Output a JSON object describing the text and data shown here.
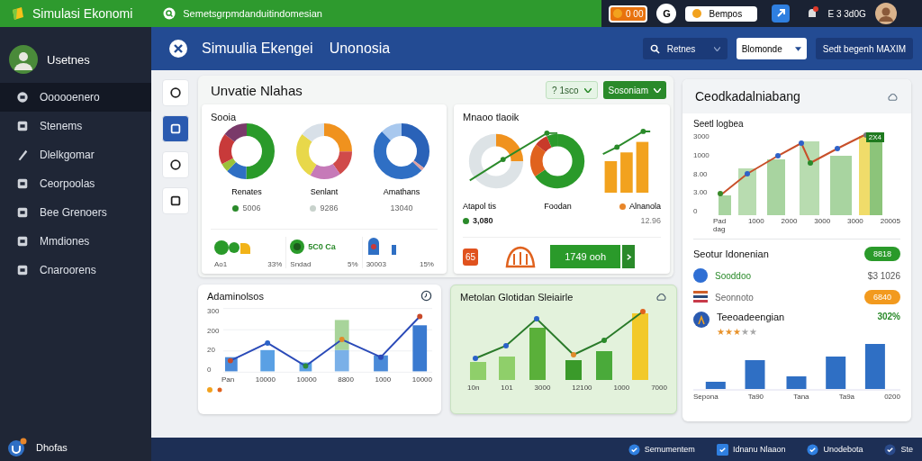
{
  "top_bar": {
    "app_title": "Simulasi Ekonomi",
    "search_text": "Semetsgrpmdanduitindomesian",
    "coin_badge": "0 00",
    "letter_button": "G",
    "points_pill": "Bempos",
    "user_text": "E 3 3d0G"
  },
  "sidebar": {
    "user_name": "Usetnes",
    "items": [
      {
        "label": "Oooooenero",
        "selected": true
      },
      {
        "label": "Stenems",
        "selected": false
      },
      {
        "label": "Dlelkgomar",
        "selected": false
      },
      {
        "label": "Ceorpoolas",
        "selected": false
      },
      {
        "label": "Bee Grenoers",
        "selected": false
      },
      {
        "label": "Mmdiones",
        "selected": false
      },
      {
        "label": "Cnaroorens",
        "selected": false
      }
    ],
    "footer_label": "Dhofas"
  },
  "header": {
    "title": "Simuulia Ekengei",
    "subtitle": "Unonosia",
    "search_button": "Retnes",
    "dropdown_value": "Blomonde",
    "action_button": "Sedt begenh MAXIM"
  },
  "tool_buttons": [
    {
      "selected": false
    },
    {
      "selected": true
    },
    {
      "selected": false
    },
    {
      "selected": false
    }
  ],
  "overview": {
    "title": "Unvatie Nlahas",
    "filter_chip": "? 1sco",
    "period_button": "Sosoniam",
    "social": {
      "title": "Sooia",
      "donuts": [
        {
          "label": "Renates",
          "value": "5006",
          "color": "#2a8a2a"
        },
        {
          "label": "Senlant",
          "value": "9286",
          "color": "#c8d2cc"
        },
        {
          "label": "Amathans",
          "value": "13040"
        }
      ],
      "stats": [
        {
          "label": "Ao1",
          "value": "33%"
        },
        {
          "label": "Sndad",
          "value": "5%",
          "note": "5C0 Ca"
        },
        {
          "label": "30003",
          "value": "15%"
        }
      ]
    },
    "market": {
      "title": "Mnaoo tlaoik",
      "charts": [
        {
          "label": "Atapol tis"
        },
        {
          "label": "Foodan"
        },
        {
          "label": "Alnanola",
          "color": "#e8862a"
        }
      ],
      "legend": [
        {
          "value": "3,080",
          "color": "#2a8a2a"
        },
        {
          "value": "12.96"
        }
      ],
      "badge_icon_text": "65",
      "amount_button": "1749 ooh"
    }
  },
  "activity_chart": {
    "title": "Adaminolsos",
    "yticks": [
      "300",
      "200",
      "20",
      "0"
    ],
    "xlabels": [
      "Pan",
      "10000",
      "10000",
      "8800",
      "1000",
      "10000"
    ]
  },
  "growth_chart": {
    "title": "Metolan Glotidan Sleiairle",
    "xlabels": [
      "10n",
      "101",
      "3000",
      "12100",
      "1000",
      "7000"
    ]
  },
  "side_panel": {
    "title": "Ceodkadalniabang",
    "chart_title": "Seetl logbea",
    "yticks": [
      "3000",
      "1000",
      "8.00",
      "3.00",
      "0"
    ],
    "xlabels": [
      "Pad dag",
      "1000",
      "2000",
      "3000",
      "3000",
      "20005"
    ],
    "peak_badge": "2X4",
    "section_title": "Seotur Idonenian",
    "section_badge": "8818",
    "rows": [
      {
        "kind": "dot",
        "label": "Sooddoo",
        "value": "$3 1026"
      },
      {
        "kind": "flag",
        "label": "Seonnoto",
        "badge": "6840"
      }
    ],
    "rating": {
      "label": "Teeoadeengian",
      "value": "302%",
      "stars": 3
    },
    "bar_labels": [
      "Sepona",
      "Ta90",
      "Tana",
      "Ta9a",
      "0200"
    ]
  },
  "status_bar": {
    "items": [
      {
        "label": "Semumentem"
      },
      {
        "label": "Idnanu Nlaaon"
      },
      {
        "label": "Unodebota"
      },
      {
        "label": "Ste"
      }
    ]
  }
}
